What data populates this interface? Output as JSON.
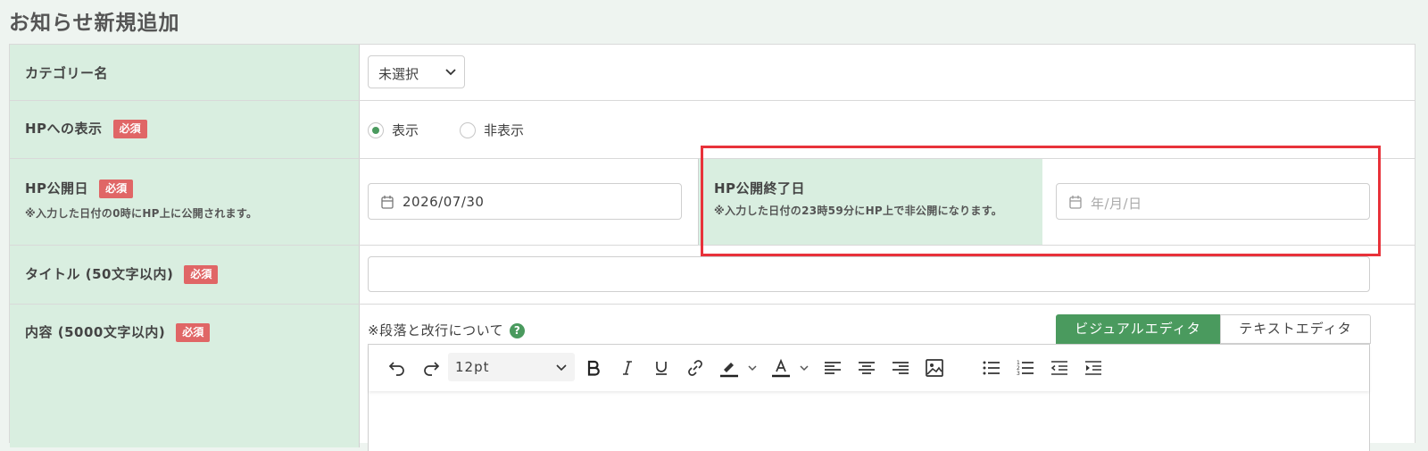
{
  "page": {
    "title": "お知らせ新規追加"
  },
  "form": {
    "category": {
      "label": "カテゴリー名",
      "selected": "未選択"
    },
    "display": {
      "label": "HPへの表示",
      "required": "必須",
      "options": [
        {
          "label": "表示",
          "checked": true
        },
        {
          "label": "非表示",
          "checked": false
        }
      ]
    },
    "publish_date": {
      "label": "HP公開日",
      "required": "必須",
      "note": "※入力した日付の0時にHP上に公開されます。",
      "value": "2026/07/30"
    },
    "end_date": {
      "label": "HP公開終了日",
      "note": "※入力した日付の23時59分にHP上で非公開になります。",
      "placeholder": "年/月/日"
    },
    "title": {
      "label": "タイトル (50文字以内)",
      "required": "必須",
      "value": ""
    },
    "content": {
      "label": "内容 (5000文字以内)",
      "required": "必須",
      "help_text": "※段落と改行について",
      "help_icon": "?",
      "tabs": [
        "ビジュアルエディタ",
        "テキストエディタ"
      ],
      "active_tab": "ビジュアルエディタ",
      "font_size": "12pt",
      "toolbar_icons": [
        "undo-icon",
        "redo-icon",
        "bold-icon",
        "italic-icon",
        "underline-icon",
        "link-icon",
        "highlight-icon",
        "text-color-icon",
        "align-left-icon",
        "align-center-icon",
        "align-right-icon",
        "image-icon",
        "bullet-list-icon",
        "numbered-list-icon",
        "outdent-icon",
        "indent-icon"
      ]
    }
  },
  "colors": {
    "accent": "#4a9a5e",
    "label_bg": "#d9eee0",
    "required": "#e06666",
    "highlight": "#e8323a"
  }
}
